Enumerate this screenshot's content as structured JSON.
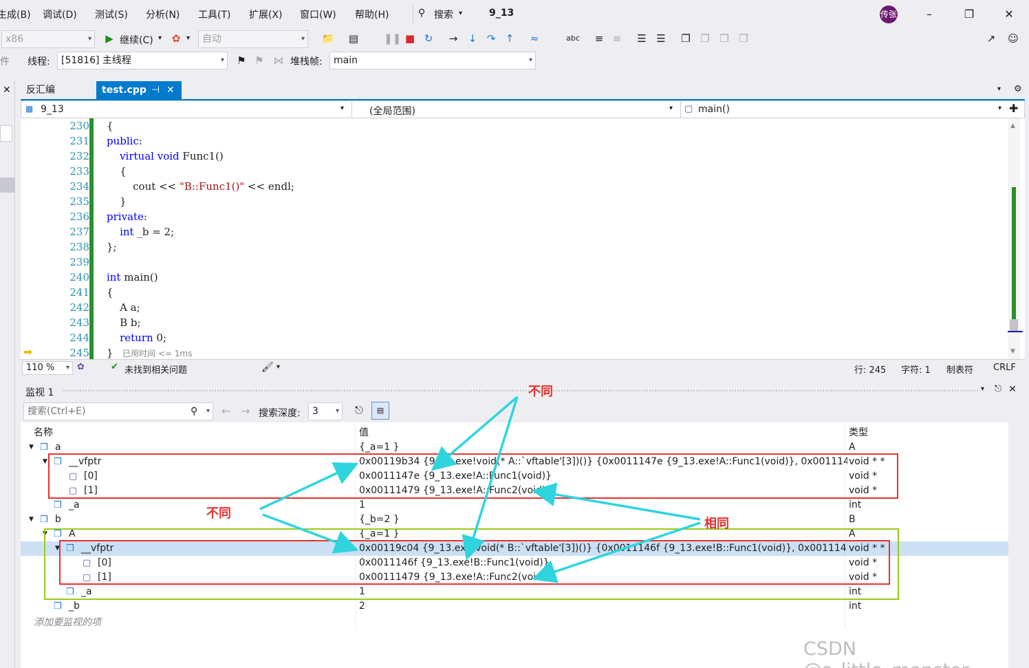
{
  "menu": [
    "生成(B)",
    "调试(D)",
    "测试(S)",
    "分析(N)",
    "工具(T)",
    "扩展(X)",
    "窗口(W)",
    "帮助(H)"
  ],
  "search_label": "搜索",
  "solution_name": "9_13",
  "user_avatar": "传张",
  "toolbar": {
    "platform": "x86",
    "continue_label": "继续(C)",
    "auto_label": "自动"
  },
  "toolbar2": {
    "event_label": "事件",
    "thread_label": "线程:",
    "thread_value": "[51816] 主线程",
    "stackframe_label": "堆栈帧:",
    "stackframe_value": "main"
  },
  "tabs": {
    "disasm": "反汇编",
    "test": "test.cpp",
    "pin_icon": "⊣",
    "close": "✕"
  },
  "navbar": {
    "project": "9_13",
    "scope": "(全局范围)",
    "function": "main()"
  },
  "code": {
    "lines": [
      {
        "num": "230",
        "text": "{"
      },
      {
        "num": "231",
        "text": "public:"
      },
      {
        "num": "232",
        "text": "    virtual void Func1()"
      },
      {
        "num": "233",
        "text": "    {"
      },
      {
        "num": "234",
        "text": "        cout << \"B::Func1()\" << endl;"
      },
      {
        "num": "235",
        "text": "    }"
      },
      {
        "num": "236",
        "text": "private:"
      },
      {
        "num": "237",
        "text": "    int _b = 2;"
      },
      {
        "num": "238",
        "text": "};"
      },
      {
        "num": "239",
        "text": ""
      },
      {
        "num": "240",
        "text": "int main()"
      },
      {
        "num": "241",
        "text": "{"
      },
      {
        "num": "242",
        "text": "    A a;"
      },
      {
        "num": "243",
        "text": "    B b;"
      },
      {
        "num": "244",
        "text": "    return 0;"
      },
      {
        "num": "245",
        "text": "}"
      }
    ],
    "perf_tip": "已用时间 <= 1ms"
  },
  "editor_status": {
    "zoom": "110 %",
    "issues": "未找到相关问题",
    "line": "行: 245",
    "char": "字符: 1",
    "tabs": "制表符",
    "eol": "CRLF"
  },
  "watch": {
    "title": "监视 1",
    "search_placeholder": "搜索(Ctrl+E)",
    "depth_label": "搜索深度:",
    "depth_value": "3",
    "col_name": "名称",
    "col_value": "值",
    "col_type": "类型",
    "rows": [
      {
        "name": "a",
        "value": "{_a=1 }",
        "type": "A"
      },
      {
        "name": "__vfptr",
        "value": "0x00119b34 {9_13.exe!void(* A::`vftable'[3])()} {0x0011147e {9_13.exe!A::Func1(void)}, 0x00111479 {9_13.ex...",
        "type": "void * *"
      },
      {
        "name": "[0]",
        "value": "0x0011147e {9_13.exe!A::Func1(void)}",
        "type": "void *"
      },
      {
        "name": "[1]",
        "value": "0x00111479 {9_13.exe!A::Func2(void)}",
        "type": "void *"
      },
      {
        "name": "_a",
        "value": "1",
        "type": "int"
      },
      {
        "name": "b",
        "value": "{_b=2 }",
        "type": "B"
      },
      {
        "name": "A",
        "value": "{_a=1 }",
        "type": "A"
      },
      {
        "name": "__vfptr",
        "value": "0x00119c04 {9_13.exe!void(* B::`vftable'[3])()} {0x0011146f {9_13.exe!B::Func1(void)}, 0x00111479 {9_13.ex...",
        "type": "void * *"
      },
      {
        "name": "[0]",
        "value": "0x0011146f {9_13.exe!B::Func1(void)}",
        "type": "void *"
      },
      {
        "name": "[1]",
        "value": "0x00111479 {9_13.exe!A::Func2(void)}",
        "type": "void *"
      },
      {
        "name": "_a",
        "value": "1",
        "type": "int"
      },
      {
        "name": "_b",
        "value": "2",
        "type": "int"
      }
    ],
    "add_item": "添加要监视的项"
  },
  "annotations": {
    "diff_top": "不同",
    "diff_left": "不同",
    "same": "相同"
  },
  "watermark": "CSDN @s_little_monster_"
}
